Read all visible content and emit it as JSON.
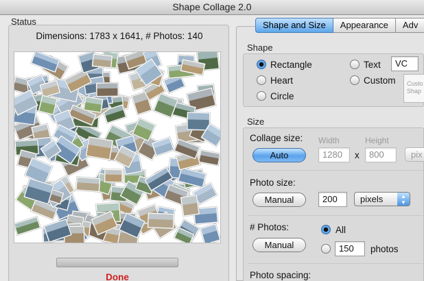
{
  "window": {
    "title": "Shape Collage 2.0"
  },
  "status": {
    "title": "Status",
    "dimensions_text": "Dimensions: 1783 x 1641, # Photos: 140",
    "progress_fraction": 1.0,
    "done_label": "Done"
  },
  "tabs": [
    {
      "label": "Shape and Size",
      "active": true
    },
    {
      "label": "Appearance",
      "active": false
    },
    {
      "label": "Adv",
      "active": false
    }
  ],
  "shape": {
    "title": "Shape",
    "options": [
      {
        "label": "Rectangle",
        "selected": true
      },
      {
        "label": "Heart",
        "selected": false
      },
      {
        "label": "Circle",
        "selected": false
      },
      {
        "label": "Text",
        "selected": false
      },
      {
        "label": "Custom",
        "selected": false
      }
    ],
    "text_value": "VC",
    "custom_hint": "Custo Shap"
  },
  "size": {
    "title": "Size",
    "collage_size_label": "Collage size:",
    "auto_button": "Auto",
    "width_label": "Width",
    "height_label": "Height",
    "width_value": "1280",
    "height_value": "800",
    "times": "x",
    "unit_partial": "pix",
    "photo_size_label": "Photo size:",
    "manual_button": "Manual",
    "photo_size_value": "200",
    "photo_size_unit": "pixels",
    "photos_label": "# Photos:",
    "photos_manual_button": "Manual",
    "all_label": "All",
    "photos_count_value": "150",
    "photos_unit": "photos",
    "photo_spacing_label": "Photo spacing:"
  },
  "colors": {
    "accent_blue": "#5aa3ec",
    "done_red": "#d02020"
  }
}
